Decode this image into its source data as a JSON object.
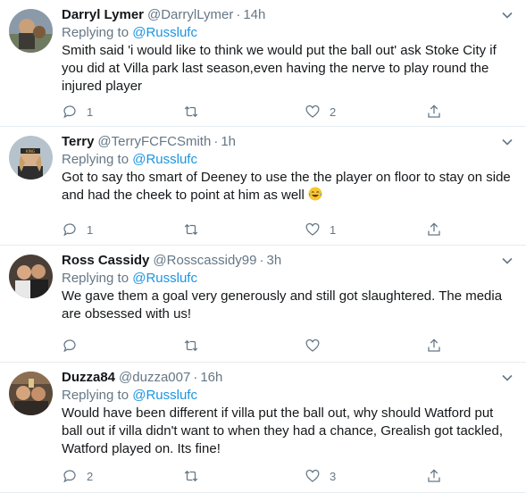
{
  "tweets": [
    {
      "name": "Darryl Lymer",
      "handle": "@DarrylLymer",
      "time": "14h",
      "replying_prefix": "Replying to",
      "replying_to": "@Russlufc",
      "text": "Smith said 'i would like to think we would put the ball out' ask Stoke City if you did at Villa park last season,even having the nerve to play round the injured player",
      "has_emoji": false,
      "replies": "1",
      "retweets": "",
      "likes": "2"
    },
    {
      "name": "Terry",
      "handle": "@TerryFCFCSmith",
      "time": "1h",
      "replying_prefix": "Replying to",
      "replying_to": "@Russlufc",
      "text": "Got to say tho smart of Deeney to use the the player on floor to stay on side and had the cheek to point at him as well ",
      "has_emoji": true,
      "replies": "1",
      "retweets": "",
      "likes": "1"
    },
    {
      "name": "Ross Cassidy",
      "handle": "@Rosscassidy99",
      "time": "3h",
      "replying_prefix": "Replying to",
      "replying_to": "@Russlufc",
      "text": "We gave them a goal very generously and still got slaughtered. The media are obsessed with us!",
      "has_emoji": false,
      "replies": "",
      "retweets": "",
      "likes": ""
    },
    {
      "name": "Duzza84",
      "handle": "@duzza007",
      "time": "16h",
      "replying_prefix": "Replying to",
      "replying_to": "@Russlufc",
      "text": "Would have been different if villa put the ball out, why should Watford put ball out if villa didn't want to when they had a chance, Grealish got tackled, Watford played on. Its fine!",
      "has_emoji": false,
      "replies": "2",
      "retweets": "",
      "likes": "3"
    }
  ],
  "icons": {
    "reply": "reply-icon",
    "retweet": "retweet-icon",
    "like": "heart-icon",
    "share": "share-icon",
    "caret": "chevron-down-icon"
  },
  "colors": {
    "text": "#14171a",
    "secondary": "#657786",
    "link": "#1b95e0",
    "divider": "#e6ecf0"
  }
}
